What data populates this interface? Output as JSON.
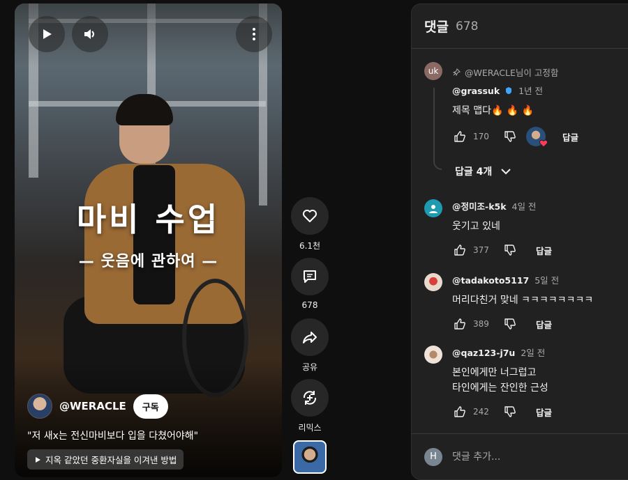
{
  "video": {
    "title_main": "마비 수업",
    "title_sub": "— 웃음에 관하여 —",
    "channel_name": "@WERACLE",
    "subscribe_label": "구독",
    "caption": "\"저 새x는 전신마비보다 입을 다쳤어야해\"",
    "linked_video": "지옥 같았던 중환자실을 이겨낸 방법",
    "icons": {
      "play": "play-icon",
      "volume": "volume-icon",
      "more": "more-vert-icon"
    }
  },
  "actions": {
    "like_count": "6.1천",
    "comment_count": "678",
    "share_label": "공유",
    "remix_label": "리믹스"
  },
  "comments_panel": {
    "title": "댓글",
    "count": "678",
    "pinned_note": "@WERACLE님이 고정함",
    "replies_toggle": "답글 4개",
    "reply_label": "답글",
    "add_placeholder": "댓글 추가...",
    "add_avatar_letter": "H",
    "comments": [
      {
        "avatar": "uk",
        "avatar_color": "#8a6a63",
        "author": "@grassuk",
        "time": "1년 전",
        "text": "제목 맵다🔥 🔥 🔥",
        "likes": "170"
      },
      {
        "avatar": "",
        "avatar_color": "#1e9bb0",
        "author": "@정미조-k5k",
        "time": "4일 전",
        "text": "웃기고 있네",
        "likes": "377"
      },
      {
        "avatar": "",
        "avatar_color": "#c7a08a",
        "author": "@tadakoto5117",
        "time": "5일 전",
        "text": "머리다친거 맞네 ㅋㅋㅋㅋㅋㅋㅋㅋ",
        "likes": "389"
      },
      {
        "avatar": "",
        "avatar_color": "#e0c7b8",
        "author": "@qaz123-j7u",
        "time": "2일 전",
        "text_lines": [
          "본인에게만 너그럽고",
          "타인에게는 잔인한 근성"
        ],
        "likes": "242"
      }
    ]
  }
}
